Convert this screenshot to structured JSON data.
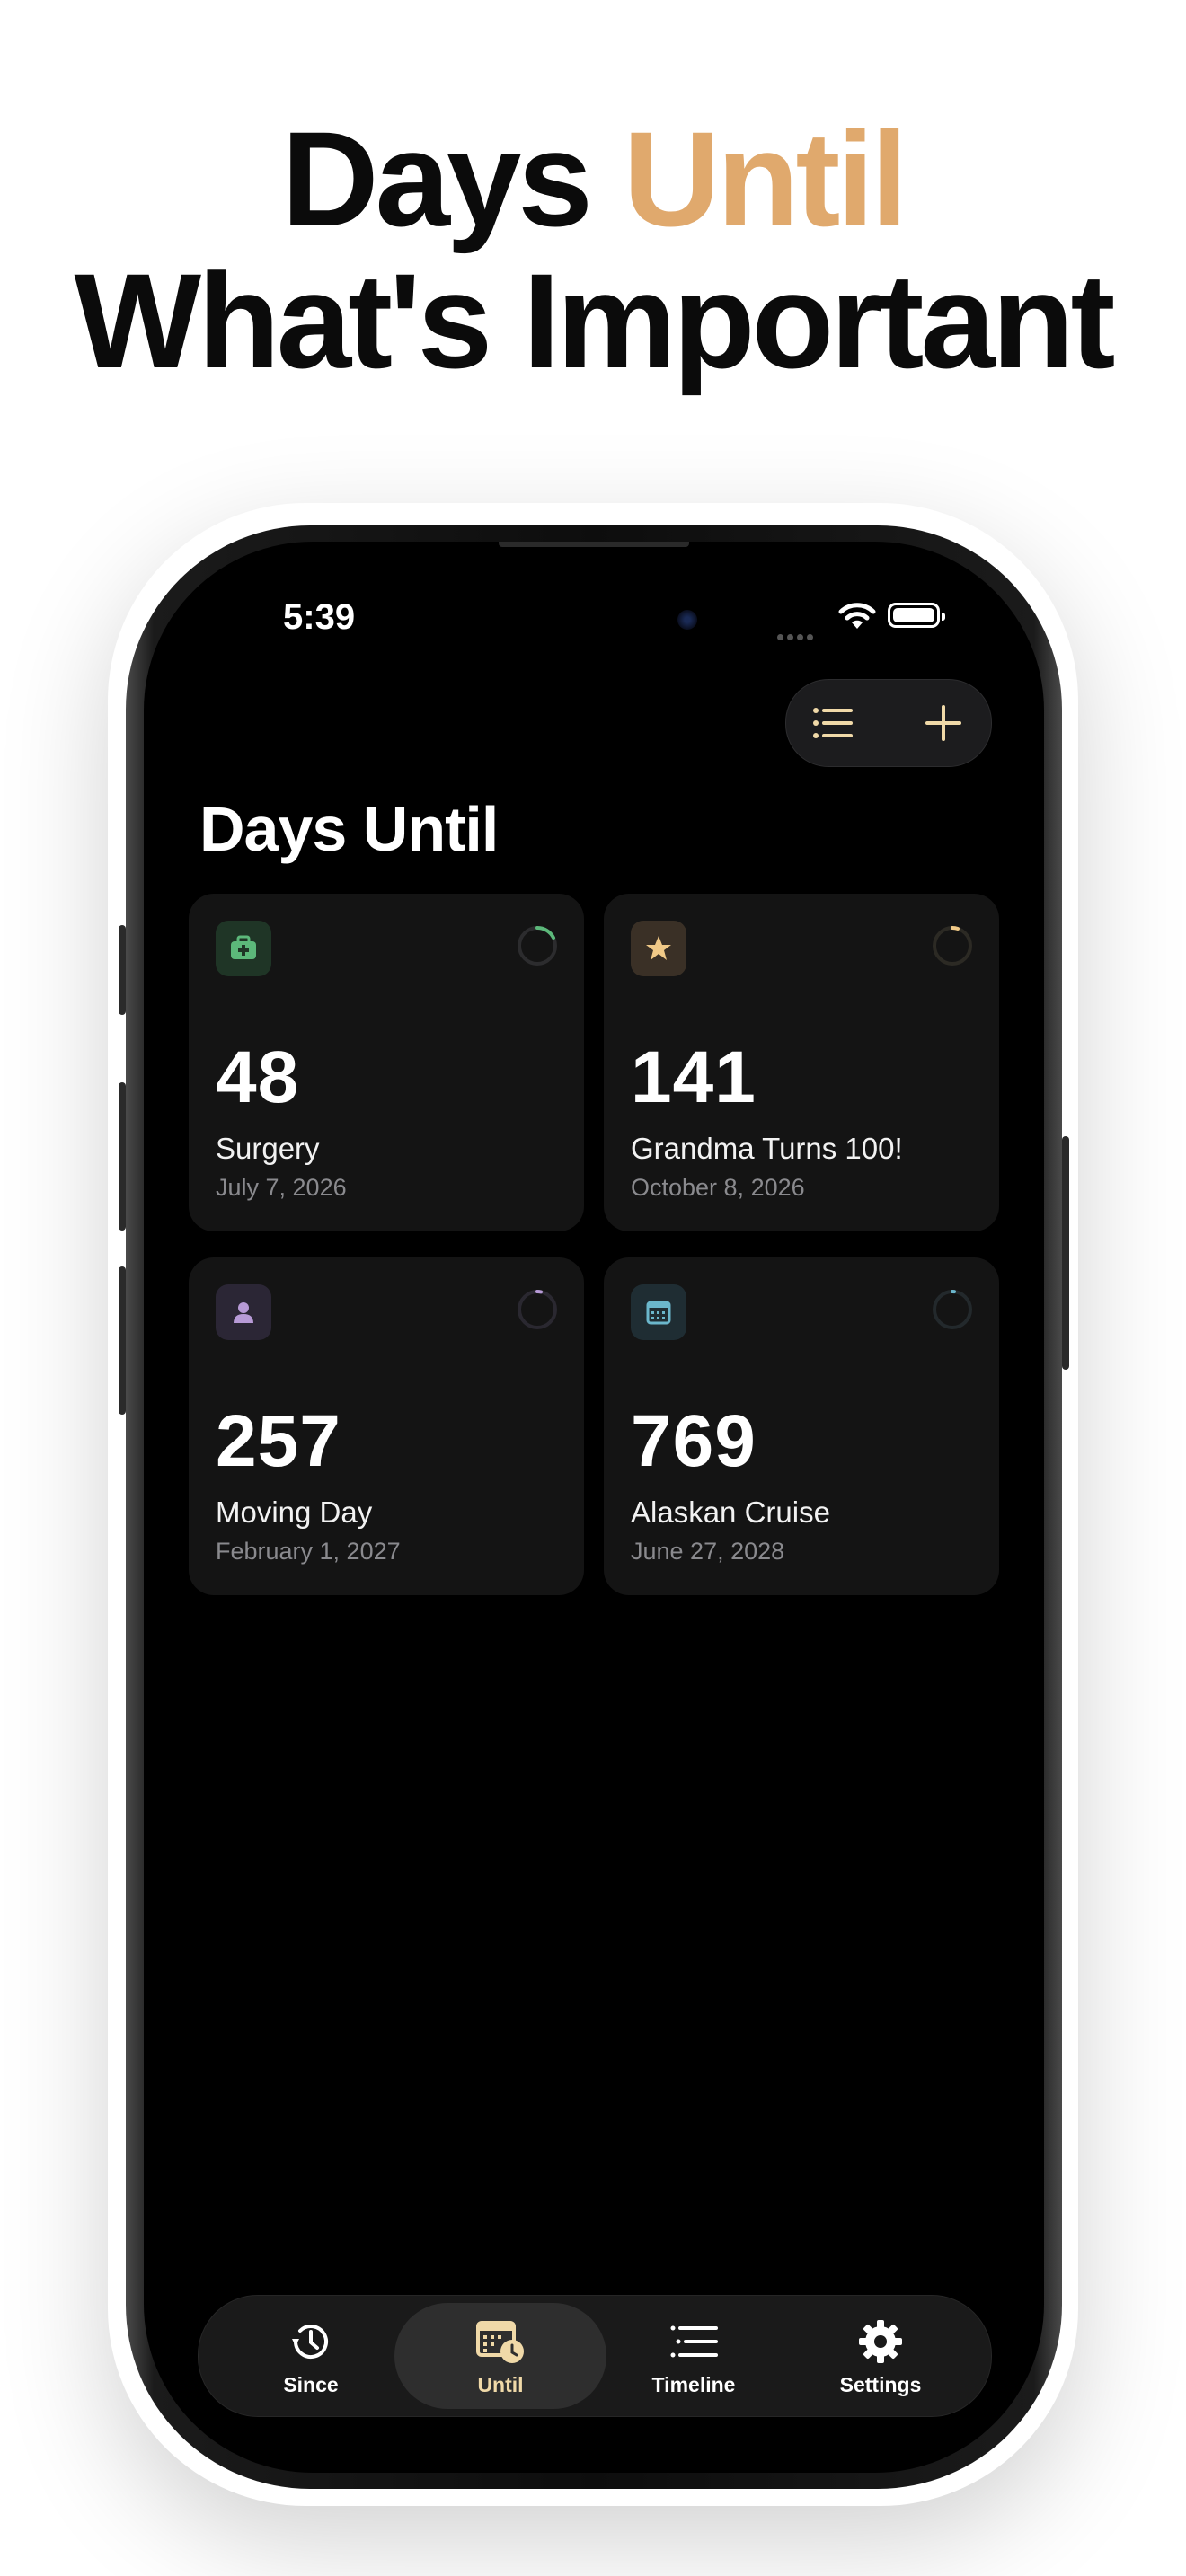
{
  "headline": {
    "line1_part1": "Days ",
    "line1_accent": "Until",
    "line2": "What's Important",
    "accent_color": "#e0a96d"
  },
  "status_bar": {
    "time": "5:39",
    "icons": [
      "wifi-icon",
      "battery-icon"
    ]
  },
  "toolbar": {
    "icons": [
      "list-icon",
      "plus-icon"
    ]
  },
  "page": {
    "title": "Days Until"
  },
  "cards": [
    {
      "days": "48",
      "name": "Surgery",
      "date": "July 7, 2026",
      "icon": "medical-kit-icon",
      "accent": "#5cb87a"
    },
    {
      "days": "141",
      "name": "Grandma Turns 100!",
      "date": "October 8, 2026",
      "icon": "star-icon",
      "accent": "#f0c987"
    },
    {
      "days": "257",
      "name": "Moving Day",
      "date": "February 1, 2027",
      "icon": "person-icon",
      "accent": "#b79ad6"
    },
    {
      "days": "769",
      "name": "Alaskan Cruise",
      "date": "June 27, 2028",
      "icon": "calendar-icon",
      "accent": "#6bb7cc"
    }
  ],
  "tabbar": {
    "tabs": [
      {
        "label": "Since",
        "icon": "history-clock-icon",
        "selected": false
      },
      {
        "label": "Until",
        "icon": "calendar-clock-icon",
        "selected": true
      },
      {
        "label": "Timeline",
        "icon": "timeline-list-icon",
        "selected": false
      },
      {
        "label": "Settings",
        "icon": "gear-icon",
        "selected": false
      }
    ]
  }
}
